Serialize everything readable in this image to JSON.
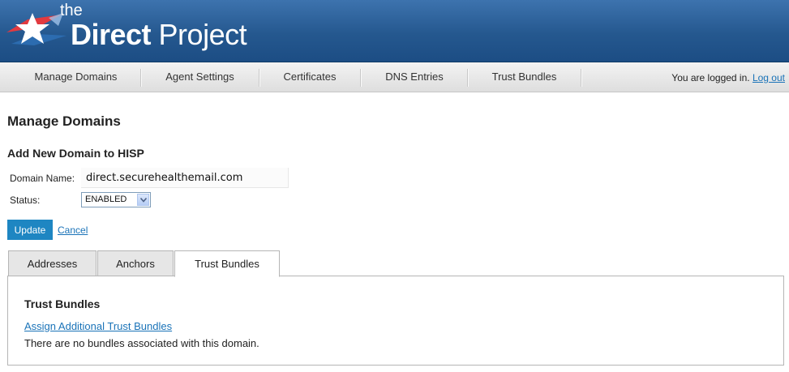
{
  "logo": {
    "the": "the",
    "title_bold": "Direct",
    "title_rest": " Project"
  },
  "nav": {
    "items": [
      "Manage Domains",
      "Agent Settings",
      "Certificates",
      "DNS Entries",
      "Trust Bundles"
    ],
    "login_text": "You are logged in.",
    "logout": "Log out"
  },
  "page": {
    "title": "Manage Domains",
    "section_title": "Add New Domain to HISP",
    "domain_label": "Domain Name:",
    "domain_value": "direct.securehealthemail.com",
    "status_label": "Status:",
    "status_value": "ENABLED",
    "update_button": "Update",
    "cancel_link": "Cancel"
  },
  "tabs": [
    {
      "label": "Addresses",
      "active": false
    },
    {
      "label": "Anchors",
      "active": false
    },
    {
      "label": "Trust Bundles",
      "active": true
    }
  ],
  "panel": {
    "title": "Trust Bundles",
    "assign_link": "Assign Additional Trust Bundles",
    "empty_text": "There are no bundles associated with this domain."
  },
  "colors": {
    "header_blue": "#25588f",
    "link_blue": "#1a73b8",
    "button_blue": "#1e86c2",
    "logo_red": "#d9363e"
  },
  "icons": [
    "direct-project-star-logo-icon",
    "select-dropdown-chevron-icon"
  ]
}
